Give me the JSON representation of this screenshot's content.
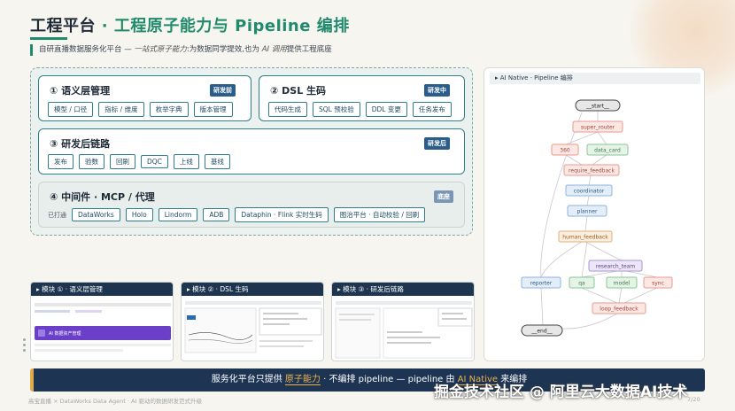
{
  "header": {
    "title_a": "工程平台",
    "sep": " · ",
    "title_b": "工程原子能力与 Pipeline 编排",
    "subtitle_a": "自研直播数据服务化平台 — ",
    "subtitle_em1": "一站式原子能力",
    "subtitle_b": ":为数据同学提效,也为 ",
    "subtitle_em2": "AI 调用",
    "subtitle_c": "提供工程底座"
  },
  "modules": {
    "m1": {
      "title": "① 语义层管理",
      "tag": "研发前",
      "chips": [
        "模型 / 口径",
        "指标 / 维度",
        "枚举字典",
        "版本管理"
      ]
    },
    "m2": {
      "title": "② DSL 生码",
      "tag": "研发中",
      "chips": [
        "代码生成",
        "SQL 预校验",
        "DDL 变更",
        "任务发布"
      ]
    },
    "m3": {
      "title": "③ 研发后链路",
      "tag": "研发后",
      "chips": [
        "发布",
        "验数",
        "回刷",
        "DQC",
        "上线",
        "基线"
      ]
    },
    "m4": {
      "title": "④ 中间件 · MCP / 代理",
      "tag": "底座",
      "prefix": "已打通",
      "chips": [
        "DataWorks",
        "Holo",
        "Lindorm",
        "ADB",
        "Dataphin · Flink 实时生码",
        "图治平台 · 自动校验 / 回刷"
      ]
    }
  },
  "pipeline": {
    "header": "▸ AI Native · Pipeline 编排",
    "nodes": {
      "start": "__start__",
      "super_router": "super_router",
      "n360": "360",
      "data_card": "data_card",
      "require_feedback": "require_feedback",
      "coordinator": "coordinator",
      "planner": "planner",
      "human_feedback": "human_feedback",
      "research_team": "research_team",
      "reporter": "reporter",
      "qa": "qa",
      "model": "model",
      "sync": "sync",
      "loop_feedback": "loop_feedback",
      "end": "__end__"
    }
  },
  "thumbs": [
    {
      "title": "▸ 模块 ① · 语义层管理",
      "banner": "AI 数据资产管理"
    },
    {
      "title": "▸ 模块 ② · DSL 生码"
    },
    {
      "title": "▸ 模块 ③ · 研发后链路"
    }
  ],
  "footer": {
    "a": "服务化平台只提供 ",
    "hl1": "原子能力",
    "b": " · 不编排 pipeline — pipeline 由 ",
    "hl2": "AI Native",
    "c": " 来编排"
  },
  "credit": "高宝直播 × DataWorks Data Agent · AI 驱动的数据研发范式升级",
  "page_no": "7/20",
  "watermark": "掘金技术社区 @ 阿里云大数据AI技术"
}
